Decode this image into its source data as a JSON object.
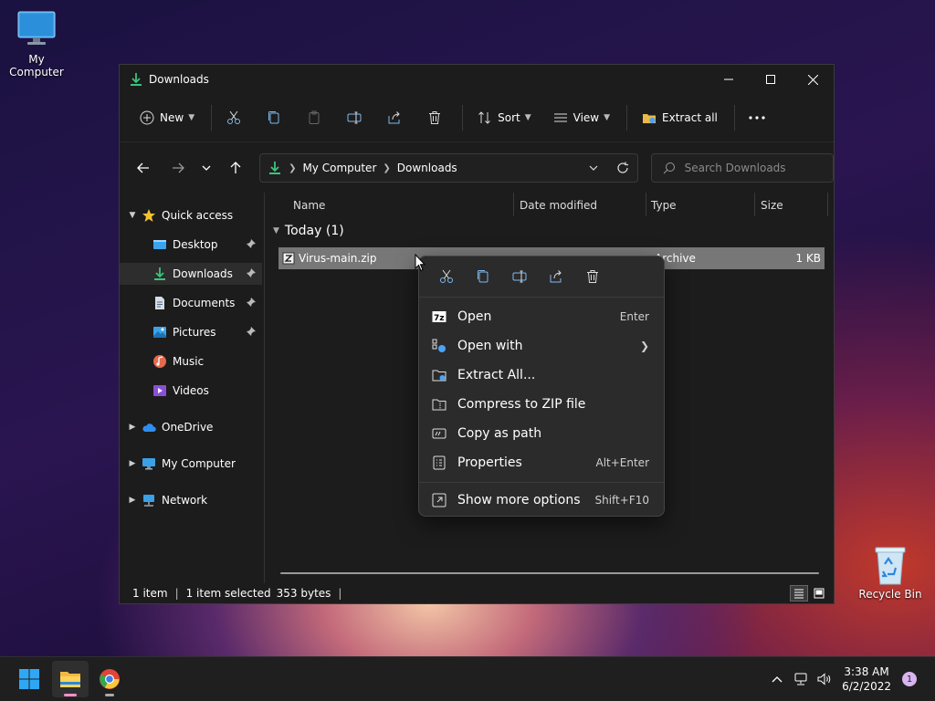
{
  "desktop": {
    "my_computer_label": "My Computer",
    "recycle_bin_label": "Recycle Bin"
  },
  "window": {
    "title": "Downloads",
    "toolbar": {
      "new_label": "New",
      "sort_label": "Sort",
      "view_label": "View",
      "extract_all_label": "Extract all"
    },
    "address": {
      "crumbs": [
        "My Computer",
        "Downloads"
      ]
    },
    "search": {
      "placeholder": "Search Downloads"
    },
    "sidebar": {
      "quick_access": "Quick access",
      "items": [
        {
          "label": "Desktop",
          "pinned": true
        },
        {
          "label": "Downloads",
          "pinned": true
        },
        {
          "label": "Documents",
          "pinned": true
        },
        {
          "label": "Pictures",
          "pinned": true
        },
        {
          "label": "Music",
          "pinned": false
        },
        {
          "label": "Videos",
          "pinned": false
        }
      ],
      "onedrive": "OneDrive",
      "my_computer": "My Computer",
      "network": "Network"
    },
    "columns": {
      "name": "Name",
      "date_modified": "Date modified",
      "type": "Type",
      "size": "Size"
    },
    "group_label": "Today (1)",
    "files": [
      {
        "name": "Virus-main.zip",
        "type": "Archive",
        "size": "1 KB"
      }
    ],
    "status": {
      "item_count": "1 item",
      "selected": "1 item selected",
      "selected_size": "353 bytes"
    }
  },
  "context_menu": {
    "items": [
      {
        "label": "Open",
        "shortcut": "Enter"
      },
      {
        "label": "Open with",
        "shortcut": ""
      },
      {
        "label": "Extract All...",
        "shortcut": ""
      },
      {
        "label": "Compress to ZIP file",
        "shortcut": ""
      },
      {
        "label": "Copy as path",
        "shortcut": ""
      },
      {
        "label": "Properties",
        "shortcut": "Alt+Enter"
      },
      {
        "label": "Show more options",
        "shortcut": "Shift+F10"
      }
    ]
  },
  "taskbar": {
    "time": "3:38 AM",
    "date": "6/2/2022",
    "notification_count": "1"
  },
  "colors": {
    "accent_green": "#3cc47c",
    "accent_blue": "#4ca3f5",
    "window_bg": "#1c1c1c",
    "menu_bg": "#2b2b2b"
  }
}
